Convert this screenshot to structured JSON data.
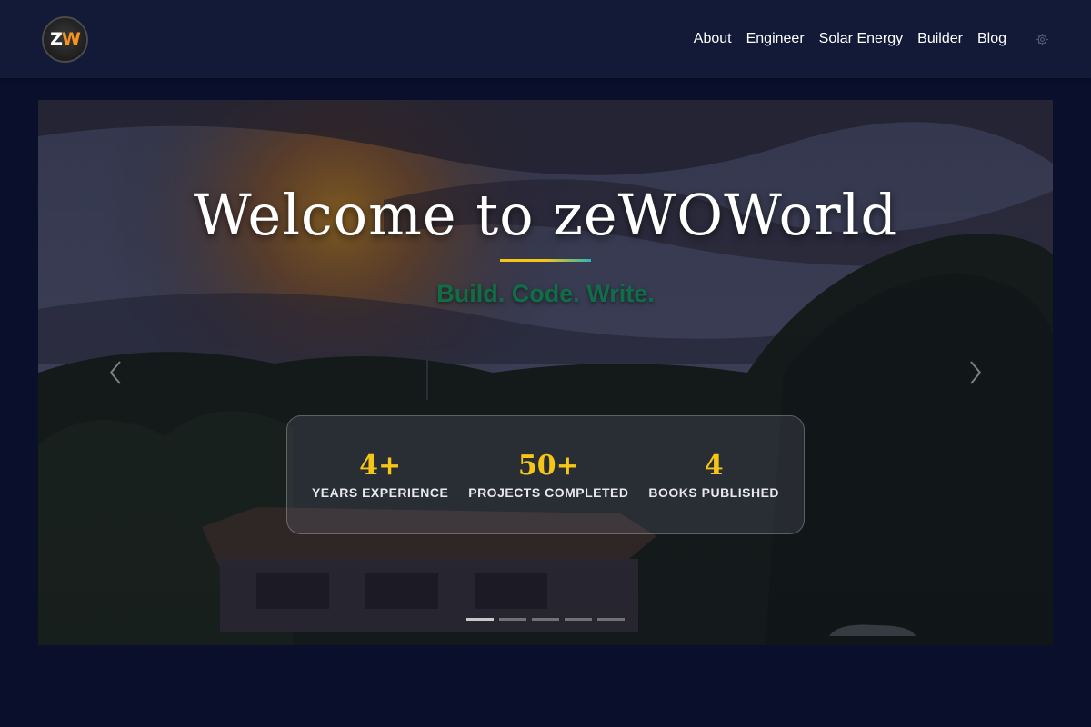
{
  "nav": {
    "logo_z": "Z",
    "logo_w": "W",
    "links": [
      "About",
      "Engineer",
      "Solar Energy",
      "Builder",
      "Blog"
    ],
    "settings_icon": "gear-icon"
  },
  "hero": {
    "title": "Welcome to zeWOWorld",
    "tagline": "Build. Code. Write.",
    "prev_icon": "chevron-left-icon",
    "next_icon": "chevron-right-icon",
    "stats": [
      {
        "value": "4+",
        "label": "YEARS EXPERIENCE"
      },
      {
        "value": "50+",
        "label": "PROJECTS COMPLETED"
      },
      {
        "value": "4",
        "label": "BOOKS PUBLISHED"
      }
    ],
    "slide_count": 5,
    "active_slide": 1
  },
  "colors": {
    "background": "#0a0f2c",
    "navbar": "#121a38",
    "accent_yellow": "#f5c518",
    "accent_teal": "#2bb5b5",
    "tagline_green": "#0f6e45",
    "logo_orange": "#f7931e"
  }
}
